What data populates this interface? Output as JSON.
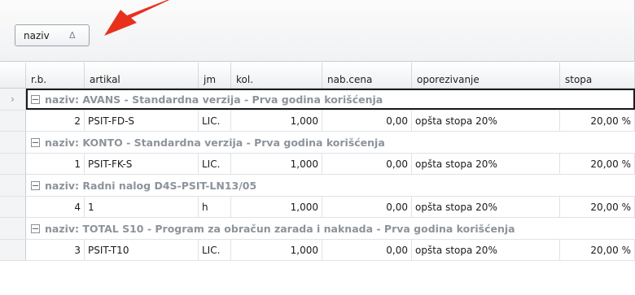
{
  "group_panel": {
    "chip_label": "naziv",
    "sort_glyph": "Δ"
  },
  "columns": [
    "r.b.",
    "artikal",
    "jm",
    "kol.",
    "nab.cena",
    "oporezivanje",
    "stopa"
  ],
  "groups": [
    {
      "label": "naziv: AVANS - Standardna verzija - Prva godina korišćenja",
      "selected": true,
      "rows": [
        {
          "rb": "2",
          "artikal": "PSIT-FD-S",
          "jm": "LIC.",
          "kol": "1,000",
          "nab": "0,00",
          "opor": "opšta stopa 20%",
          "stopa": "20,00 %"
        }
      ]
    },
    {
      "label": "naziv: KONTO - Standardna verzija - Prva godina korišćenja",
      "selected": false,
      "rows": [
        {
          "rb": "1",
          "artikal": "PSIT-FK-S",
          "jm": "LIC.",
          "kol": "1,000",
          "nab": "0,00",
          "opor": "opšta stopa 20%",
          "stopa": "20,00 %"
        }
      ]
    },
    {
      "label": "naziv: Radni nalog D4S-PSIT-LN13/05",
      "selected": false,
      "rows": [
        {
          "rb": "4",
          "artikal": "1",
          "jm": "h",
          "kol": "1,000",
          "nab": "0,00",
          "opor": "opšta stopa 20%",
          "stopa": "20,00 %"
        }
      ]
    },
    {
      "label": "naziv: TOTAL S10 - Program za obračun zarada i naknada - Prva godina korišćenja",
      "selected": false,
      "rows": [
        {
          "rb": "3",
          "artikal": "PSIT-T10",
          "jm": "LIC.",
          "kol": "1,000",
          "nab": "0,00",
          "opor": "opšta stopa 20%",
          "stopa": "20,00 %"
        }
      ]
    }
  ],
  "colors": {
    "arrow": "#e8311c",
    "group_text": "#8c939b",
    "selection_border": "#1b1b1b"
  },
  "icons": {
    "row_indicator": "chevron-right-icon",
    "collapse": "minus-box-icon",
    "annotation": "red-arrow-icon"
  }
}
